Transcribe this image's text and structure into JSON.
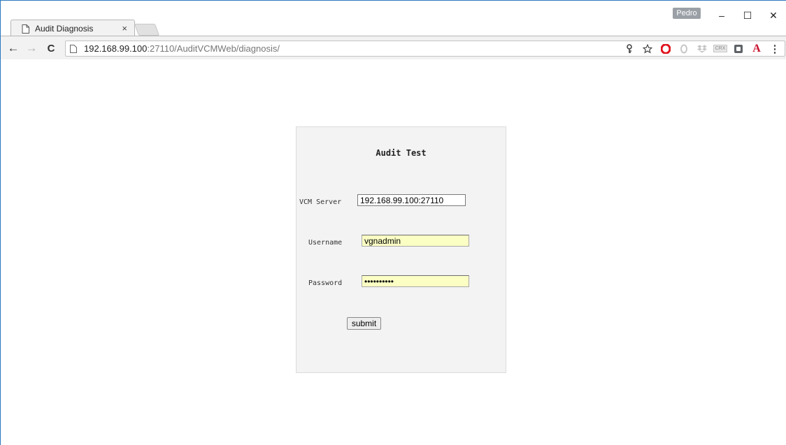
{
  "browser": {
    "tab": {
      "title": "Audit Diagnosis",
      "close_glyph": "×"
    },
    "profile": "Pedro",
    "window_controls": {
      "minimize": "–",
      "maximize": "☐",
      "close": "✕"
    },
    "nav": {
      "back": "←",
      "forward": "→",
      "reload": "C"
    },
    "url": {
      "host": "192.168.99.100",
      "rest": ":27110/AuditVCMWeb/diagnosis/"
    },
    "extensions": [
      "key-icon",
      "star-icon",
      "opera-icon",
      "extension-icon",
      "dropbox-icon",
      "crx-icon",
      "pocket-icon",
      "font-a-icon",
      "menu-icon"
    ],
    "extension_glyphs": {
      "crx": "CRX",
      "font": "A",
      "menu": "⋮"
    }
  },
  "form": {
    "title": "Audit Test",
    "vcm_server_label": "VCM Server",
    "vcm_server_value": "192.168.99.100:27110",
    "username_label": "Username",
    "username_value": "vgnadmin",
    "password_label": "Password",
    "password_value": "••••••••••",
    "submit_label": "submit"
  },
  "colors": {
    "autofill_bg": "#fbffc4",
    "panel_bg": "#f3f3f3",
    "window_border": "#2b79c0"
  }
}
